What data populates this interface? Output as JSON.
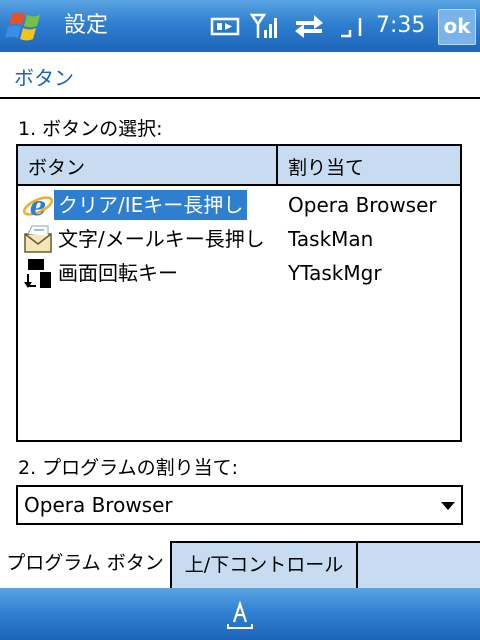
{
  "titlebar": {
    "title": "設定",
    "clock": "7:35",
    "ok_label": "ok"
  },
  "header": {
    "title": "ボタン"
  },
  "section1": {
    "label": "1. ボタンの選択:"
  },
  "listview": {
    "columns": [
      "ボタン",
      "割り当て"
    ],
    "rows": [
      {
        "name": "クリア/IEキー長押し",
        "assign": "Opera Browser",
        "icon": "internet-explorer-icon",
        "selected": true
      },
      {
        "name": "文字/メールキー長押し",
        "assign": "TaskMan",
        "icon": "mail-envelope-icon",
        "selected": false
      },
      {
        "name": "画面回転キー",
        "assign": "YTaskMgr",
        "icon": "screen-rotate-icon",
        "selected": false
      }
    ]
  },
  "section2": {
    "label": "2. プログラムの割り当て:"
  },
  "dropdown": {
    "value": "Opera Browser"
  },
  "tabs": [
    {
      "label": "プログラム ボタン",
      "active": true
    },
    {
      "label": "上/下コントロール",
      "active": false
    }
  ],
  "colors": {
    "title_bar": "#2f7fd0",
    "header_text": "#1f64b4",
    "list_header_bg": "#c7dcf1",
    "selection": "#2f7fd0"
  }
}
